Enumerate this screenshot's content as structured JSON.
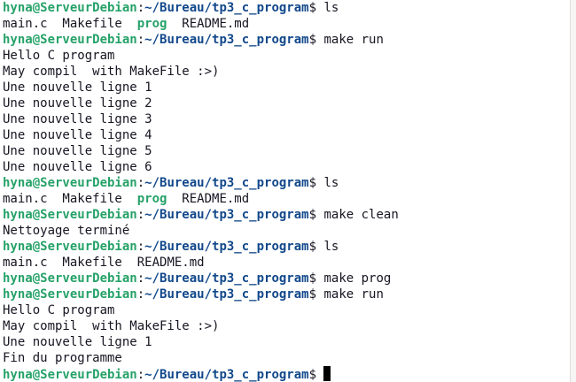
{
  "prompt": {
    "user_host": "hyna@ServeurDebian",
    "colon": ":",
    "path": "~/Bureau/tp3_c_program",
    "symbol": "$"
  },
  "lines": [
    {
      "type": "prompt",
      "command": " ls"
    },
    {
      "type": "ls",
      "items": [
        {
          "text": "main.c",
          "exec": false
        },
        {
          "text": "  Makefile",
          "exec": false
        },
        {
          "text": "  ",
          "exec": false
        },
        {
          "text": "prog",
          "exec": true
        },
        {
          "text": "  README.md",
          "exec": false
        }
      ]
    },
    {
      "type": "prompt",
      "command": " make run"
    },
    {
      "type": "output",
      "text": "Hello C program"
    },
    {
      "type": "output",
      "text": "May compil  with MakeFile :>)"
    },
    {
      "type": "output",
      "text": "Une nouvelle ligne 1"
    },
    {
      "type": "output",
      "text": "Une nouvelle ligne 2"
    },
    {
      "type": "output",
      "text": "Une nouvelle ligne 3"
    },
    {
      "type": "output",
      "text": "Une nouvelle ligne 4"
    },
    {
      "type": "output",
      "text": "Une nouvelle ligne 5"
    },
    {
      "type": "output",
      "text": "Une nouvelle ligne 6"
    },
    {
      "type": "prompt",
      "command": " ls"
    },
    {
      "type": "ls",
      "items": [
        {
          "text": "main.c",
          "exec": false
        },
        {
          "text": "  Makefile",
          "exec": false
        },
        {
          "text": "  ",
          "exec": false
        },
        {
          "text": "prog",
          "exec": true
        },
        {
          "text": "  README.md",
          "exec": false
        }
      ]
    },
    {
      "type": "prompt",
      "command": " make clean"
    },
    {
      "type": "output",
      "text": "Nettoyage terminé"
    },
    {
      "type": "prompt",
      "command": " ls"
    },
    {
      "type": "ls",
      "items": [
        {
          "text": "main.c",
          "exec": false
        },
        {
          "text": "  Makefile",
          "exec": false
        },
        {
          "text": "  README.md",
          "exec": false
        }
      ]
    },
    {
      "type": "prompt",
      "command": " make prog"
    },
    {
      "type": "prompt",
      "command": " make run"
    },
    {
      "type": "output",
      "text": "Hello C program"
    },
    {
      "type": "output",
      "text": "May compil  with MakeFile :>)"
    },
    {
      "type": "output",
      "text": "Une nouvelle ligne 1"
    },
    {
      "type": "output",
      "text": "Fin du programme"
    },
    {
      "type": "prompt",
      "command": " ",
      "cursor": true
    }
  ],
  "colors": {
    "user_host": "#26a269",
    "path": "#12488b",
    "executable": "#26a269",
    "text": "#171421",
    "background": "#ffffff"
  }
}
